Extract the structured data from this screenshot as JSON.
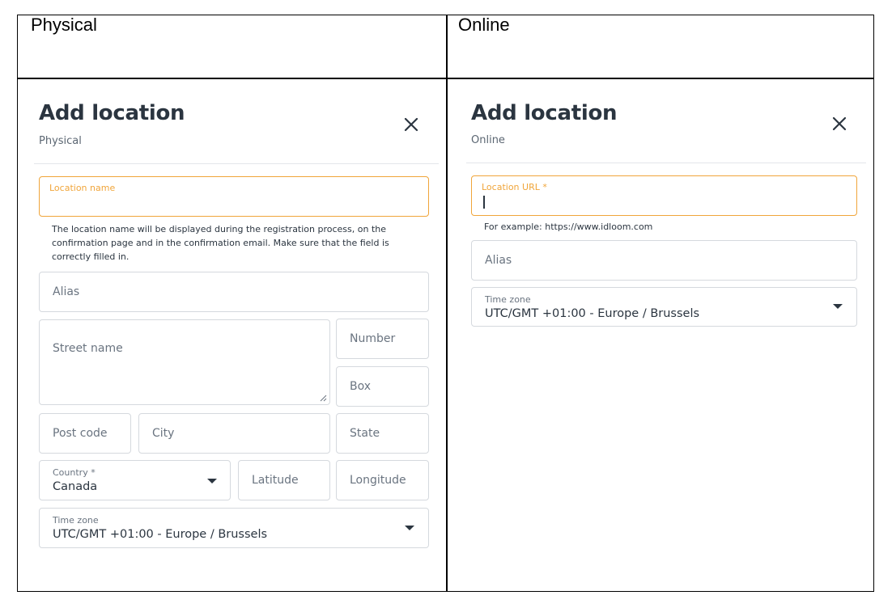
{
  "columns": {
    "left_header": "Physical",
    "right_header": "Online"
  },
  "physical": {
    "title": "Add location",
    "subtitle": "Physical",
    "close_icon": "close-icon",
    "location_name_label": "Location name",
    "location_name_value": "",
    "helper_text": "The location name will be displayed during the registration process, on the confirmation page and in the confirmation email. Make sure that the field is correctly filled in.",
    "alias_placeholder": "Alias",
    "street_placeholder": "Street name",
    "number_placeholder": "Number",
    "box_placeholder": "Box",
    "postcode_placeholder": "Post code",
    "city_placeholder": "City",
    "state_placeholder": "State",
    "country_label": "Country *",
    "country_value": "Canada",
    "latitude_placeholder": "Latitude",
    "longitude_placeholder": "Longitude",
    "timezone_label": "Time zone",
    "timezone_value": "UTC/GMT +01:00 - Europe / Brussels"
  },
  "online": {
    "title": "Add location",
    "subtitle": "Online",
    "close_icon": "close-icon",
    "url_label": "Location URL *",
    "url_value": "",
    "url_helper": "For example: https://www.idloom.com",
    "alias_placeholder": "Alias",
    "timezone_label": "Time zone",
    "timezone_value": "UTC/GMT +01:00 - Europe / Brussels"
  },
  "colors": {
    "accent_focus": "#f0a53a",
    "text_dark": "#2b3540",
    "border": "#d5d9de"
  }
}
